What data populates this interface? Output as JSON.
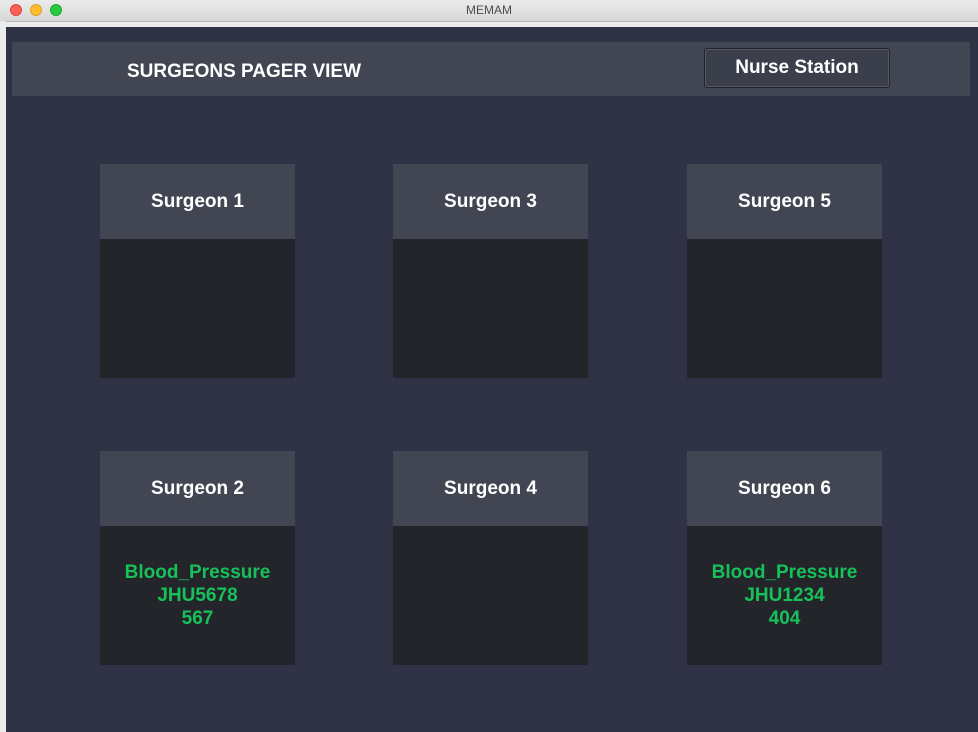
{
  "window": {
    "title": "MEMAM"
  },
  "header": {
    "title": "SURGEONS PAGER VIEW",
    "nurse_station_label": "Nurse Station"
  },
  "surgeons": [
    {
      "name": "Surgeon 1",
      "alert": null
    },
    {
      "name": "Surgeon 3",
      "alert": null
    },
    {
      "name": "Surgeon 5",
      "alert": null
    },
    {
      "name": "Surgeon 2",
      "alert": {
        "type": "Blood_Pressure",
        "patient_id": "JHU5678",
        "value": "567"
      }
    },
    {
      "name": "Surgeon 4",
      "alert": null
    },
    {
      "name": "Surgeon 6",
      "alert": {
        "type": "Blood_Pressure",
        "patient_id": "JHU1234",
        "value": "404"
      }
    }
  ],
  "colors": {
    "background": "#303346",
    "panel": "#424552",
    "card_body": "#24252a",
    "alert_text": "#16c15a"
  }
}
